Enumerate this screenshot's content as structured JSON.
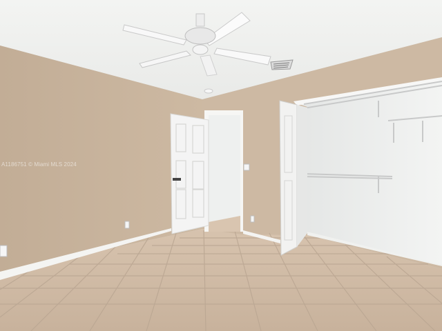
{
  "photo": {
    "watermark": "A1186751 © Miami MLS 2024",
    "scene_elements": [
      "ceiling-fan-icon",
      "air-vent-icon",
      "interior-door",
      "closet-bifold-door",
      "closet-wire-shelf",
      "light-switch",
      "wall-outlet",
      "tile-floor"
    ]
  },
  "colors": {
    "ceiling": "#f1f2f0",
    "wall_left": "#c7b39d",
    "wall_back": "#cdb9a3",
    "closet_interior": "#eceeed",
    "door": "#f4f4f4",
    "baseboard": "#f5f5f3",
    "floor_tile": "#cfbaa5",
    "grout": "#b9a592"
  }
}
